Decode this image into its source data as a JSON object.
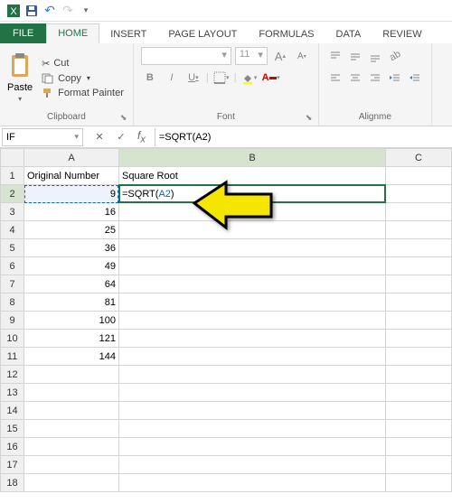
{
  "qat": {
    "save": "💾",
    "undo": "↶",
    "redo": "↷"
  },
  "tabs": {
    "file": "FILE",
    "home": "HOME",
    "insert": "INSERT",
    "page_layout": "PAGE LAYOUT",
    "formulas": "FORMULAS",
    "data": "DATA",
    "review": "REVIEW"
  },
  "clipboard": {
    "label": "Clipboard",
    "paste": "Paste",
    "cut": "Cut",
    "copy": "Copy",
    "painter": "Format Painter"
  },
  "font": {
    "label": "Font",
    "size": "11",
    "bold": "B",
    "italic": "I",
    "underline": "U",
    "inc": "A",
    "dec": "A"
  },
  "alignment": {
    "label": "Alignme"
  },
  "namebox": {
    "value": "IF"
  },
  "formula_bar": {
    "value": "=SQRT(A2)"
  },
  "columns": {
    "a": "A",
    "b": "B",
    "c": "C"
  },
  "headers": {
    "a": "Original Number",
    "b": "Square Root"
  },
  "data_rows": [
    {
      "row": 2,
      "a": "9",
      "b_formula": "=SQRT(",
      "b_ref": "A2",
      "b_close": ")"
    },
    {
      "row": 3,
      "a": "16"
    },
    {
      "row": 4,
      "a": "25"
    },
    {
      "row": 5,
      "a": "36"
    },
    {
      "row": 6,
      "a": "49"
    },
    {
      "row": 7,
      "a": "64"
    },
    {
      "row": 8,
      "a": "81"
    },
    {
      "row": 9,
      "a": "100"
    },
    {
      "row": 10,
      "a": "121"
    },
    {
      "row": 11,
      "a": "144"
    }
  ],
  "empty_rows": [
    12,
    13,
    14,
    15,
    16,
    17,
    18
  ]
}
